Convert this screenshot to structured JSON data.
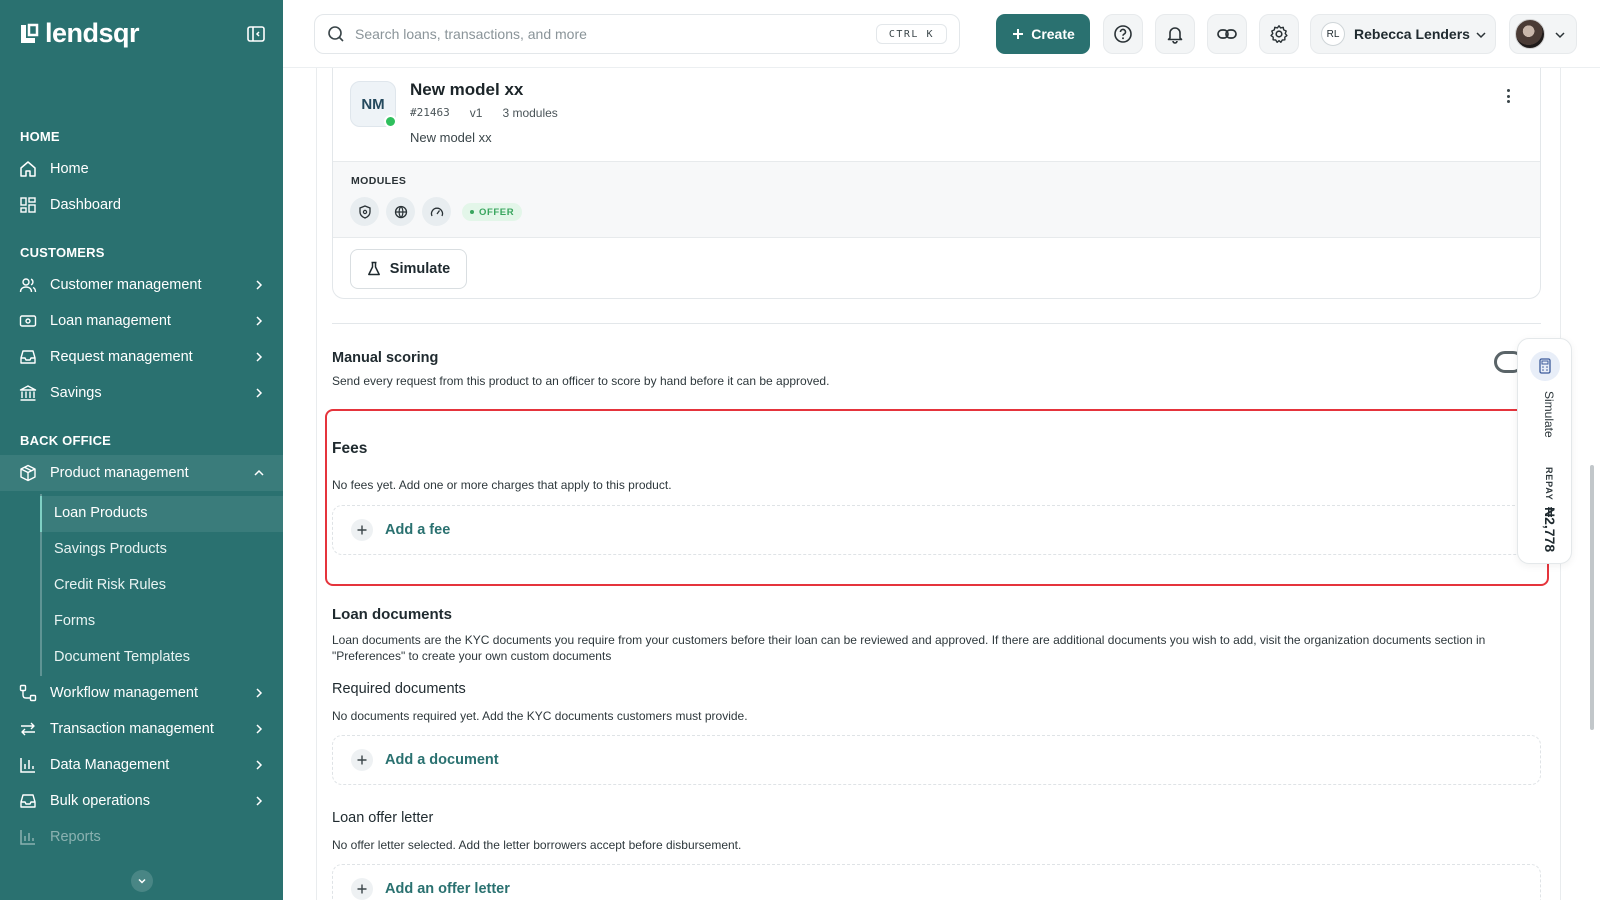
{
  "app": {
    "logo_text": "lendsqr"
  },
  "sidebar": {
    "sections": {
      "home": "HOME",
      "customers": "CUSTOMERS",
      "back_office": "BACK OFFICE"
    },
    "items": {
      "home": "Home",
      "dashboard": "Dashboard",
      "customer_management": "Customer management",
      "loan_management": "Loan management",
      "request_management": "Request management",
      "savings": "Savings",
      "product_management": "Product management",
      "workflow_management": "Workflow management",
      "transaction_management": "Transaction management",
      "data_management": "Data Management",
      "bulk_operations": "Bulk operations",
      "reports": "Reports"
    },
    "product_sub_items": [
      "Loan Products",
      "Savings Products",
      "Credit Risk Rules",
      "Forms",
      "Document Templates"
    ]
  },
  "topbar": {
    "search_placeholder": "Search loans, transactions, and more",
    "shortcut": "CTRL K",
    "create_label": "Create",
    "user_initials": "RL",
    "user_name": "Rebecca Lenders"
  },
  "model": {
    "initials": "NM",
    "name": "New model xx",
    "id": "#21463",
    "version": "v1",
    "modules_count": "3 modules",
    "description": "New model xx",
    "modules_label": "MODULES",
    "offer_badge": "OFFER",
    "simulate_label": "Simulate"
  },
  "manual_scoring": {
    "title": "Manual scoring",
    "description": "Send every request from this product to an officer to score by hand before it can be approved."
  },
  "fees": {
    "title": "Fees",
    "empty_text": "No fees yet. Add one or more charges that apply to this product.",
    "add_label": "Add a fee"
  },
  "loan_documents": {
    "title": "Loan documents",
    "description_line1": "Loan documents are the KYC documents you require from your customers before their loan can be reviewed and approved. If there are additional documents you wish to add, visit the organization documents section in",
    "description_line2": "\"Preferences\" to create your own custom documents",
    "required_title": "Required documents",
    "required_empty": "No documents required yet. Add the KYC documents customers must provide.",
    "add_document_label": "Add a document"
  },
  "offer_letter": {
    "title": "Loan offer letter",
    "empty_text": "No offer letter selected. Add the letter borrowers accept before disbursement.",
    "add_label": "Add an offer letter"
  },
  "simulate_panel": {
    "label": "Simulate",
    "repay_label": "REPAY",
    "repay_value": "₦2,778"
  },
  "colors": {
    "sidebar_bg": "#2a7170",
    "primary": "#2a7170",
    "highlight_border": "#e5343c",
    "online": "#2fbf5d",
    "offer_green": "#39a55e"
  }
}
